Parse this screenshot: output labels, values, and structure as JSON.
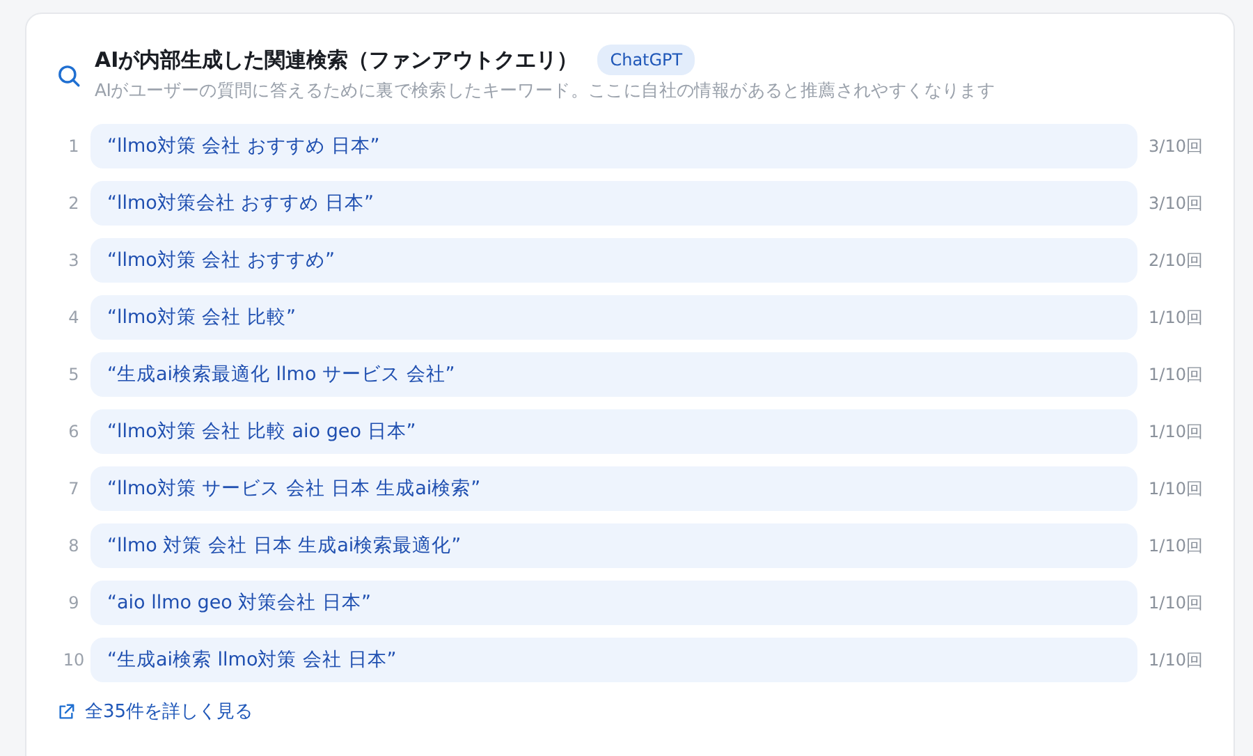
{
  "header": {
    "title": "AIが内部生成した関連検索（ファンアウトクエリ）",
    "badge": "ChatGPT",
    "subtitle": "AIがユーザーの質問に答えるために裏で検索したキーワード。ここに自社の情報があると推薦されやすくなります"
  },
  "queries": [
    {
      "rank": "1",
      "query": "“llmo対策 会社 おすすめ 日本”",
      "count": "3/10回"
    },
    {
      "rank": "2",
      "query": "“llmo対策会社 おすすめ 日本”",
      "count": "3/10回"
    },
    {
      "rank": "3",
      "query": "“llmo対策 会社 おすすめ”",
      "count": "2/10回"
    },
    {
      "rank": "4",
      "query": "“llmo対策 会社 比較”",
      "count": "1/10回"
    },
    {
      "rank": "5",
      "query": "“生成ai検索最適化 llmo サービス 会社”",
      "count": "1/10回"
    },
    {
      "rank": "6",
      "query": "“llmo対策 会社 比較 aio geo 日本”",
      "count": "1/10回"
    },
    {
      "rank": "7",
      "query": "“llmo対策 サービス 会社 日本 生成ai検索”",
      "count": "1/10回"
    },
    {
      "rank": "8",
      "query": "“llmo 対策 会社 日本 生成ai検索最適化”",
      "count": "1/10回"
    },
    {
      "rank": "9",
      "query": "“aio llmo geo 対策会社 日本”",
      "count": "1/10回"
    },
    {
      "rank": "10",
      "query": "“生成ai検索 llmo対策 会社 日本”",
      "count": "1/10回"
    }
  ],
  "more_link": "全35件を詳しく見る"
}
